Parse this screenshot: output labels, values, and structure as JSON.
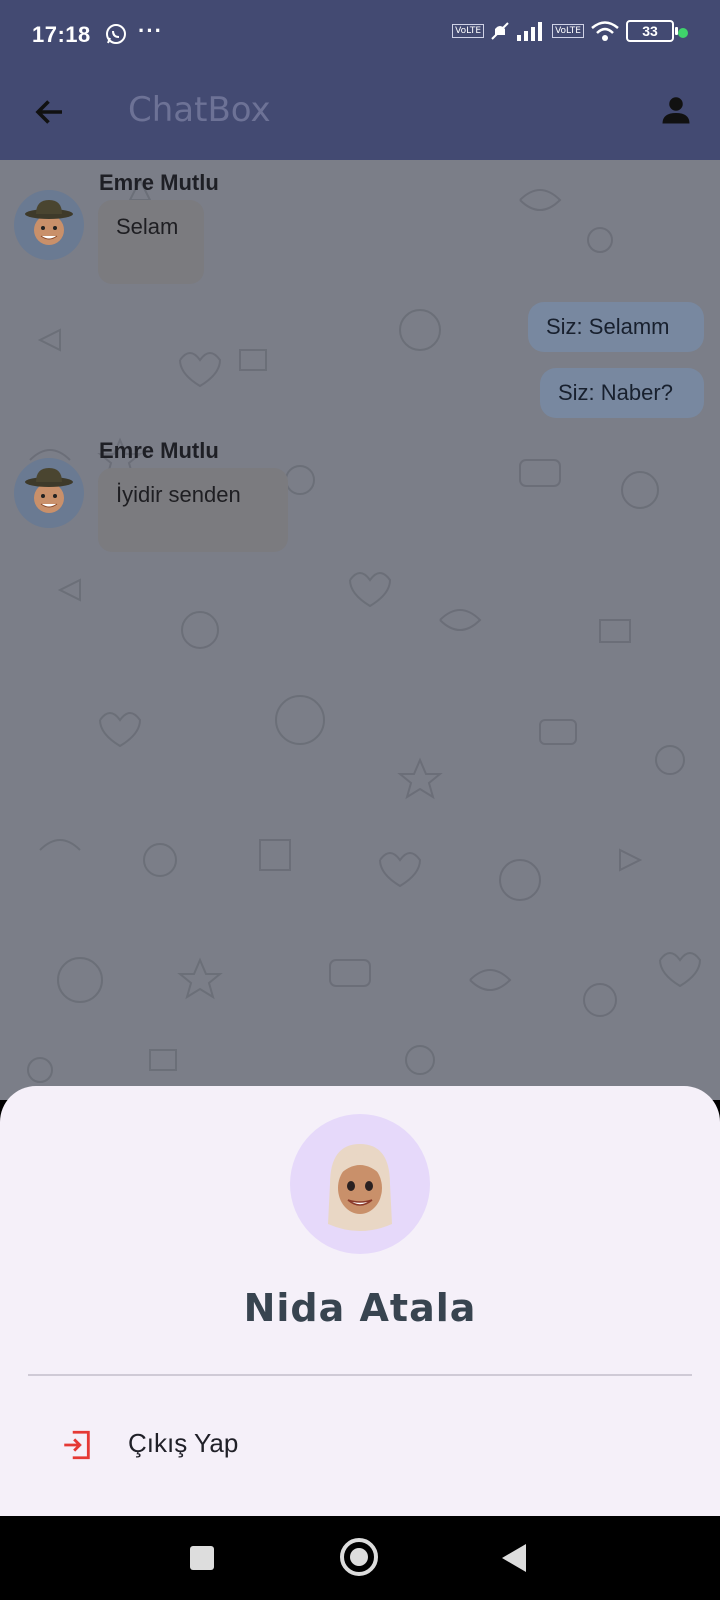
{
  "status_bar": {
    "time": "17:18",
    "more": "···",
    "battery": "33",
    "network_tag_1": "VoLTE",
    "network_tag_2": "VoLTE"
  },
  "app_bar": {
    "title": "ChatBox",
    "back_icon": "arrow-left-icon",
    "profile_icon": "person-icon"
  },
  "messages": [
    {
      "sender": "Emre Mutlu",
      "text": "Selam",
      "direction": "in"
    },
    {
      "sender": "Siz",
      "text": "Siz: Selamm",
      "direction": "out"
    },
    {
      "sender": "Siz",
      "text": "Siz: Naber?",
      "direction": "out"
    },
    {
      "sender": "Emre Mutlu",
      "text": "İyidir senden",
      "direction": "in"
    }
  ],
  "profile_sheet": {
    "user_name": "Nida Atala",
    "logout_label": "Çıkış Yap",
    "logout_icon": "logout-icon",
    "accent_color": "#e53935"
  },
  "colors": {
    "app_bar": "#434a72",
    "sheet_bg": "#f5f0f9",
    "avatar_bg": "#e6d9fa"
  }
}
